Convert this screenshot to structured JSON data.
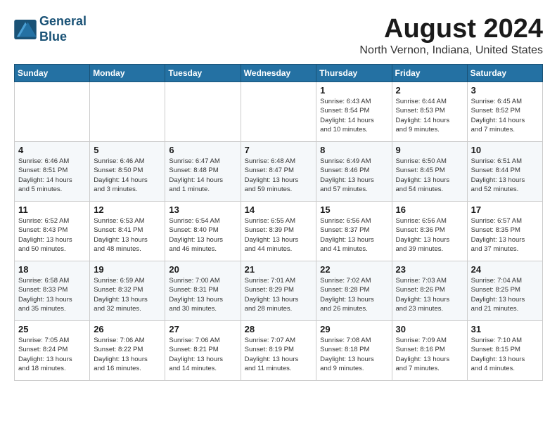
{
  "header": {
    "logo_line1": "General",
    "logo_line2": "Blue",
    "month_title": "August 2024",
    "location": "North Vernon, Indiana, United States"
  },
  "weekdays": [
    "Sunday",
    "Monday",
    "Tuesday",
    "Wednesday",
    "Thursday",
    "Friday",
    "Saturday"
  ],
  "weeks": [
    [
      {
        "day": "",
        "info": ""
      },
      {
        "day": "",
        "info": ""
      },
      {
        "day": "",
        "info": ""
      },
      {
        "day": "",
        "info": ""
      },
      {
        "day": "1",
        "info": "Sunrise: 6:43 AM\nSunset: 8:54 PM\nDaylight: 14 hours\nand 10 minutes."
      },
      {
        "day": "2",
        "info": "Sunrise: 6:44 AM\nSunset: 8:53 PM\nDaylight: 14 hours\nand 9 minutes."
      },
      {
        "day": "3",
        "info": "Sunrise: 6:45 AM\nSunset: 8:52 PM\nDaylight: 14 hours\nand 7 minutes."
      }
    ],
    [
      {
        "day": "4",
        "info": "Sunrise: 6:46 AM\nSunset: 8:51 PM\nDaylight: 14 hours\nand 5 minutes."
      },
      {
        "day": "5",
        "info": "Sunrise: 6:46 AM\nSunset: 8:50 PM\nDaylight: 14 hours\nand 3 minutes."
      },
      {
        "day": "6",
        "info": "Sunrise: 6:47 AM\nSunset: 8:48 PM\nDaylight: 14 hours\nand 1 minute."
      },
      {
        "day": "7",
        "info": "Sunrise: 6:48 AM\nSunset: 8:47 PM\nDaylight: 13 hours\nand 59 minutes."
      },
      {
        "day": "8",
        "info": "Sunrise: 6:49 AM\nSunset: 8:46 PM\nDaylight: 13 hours\nand 57 minutes."
      },
      {
        "day": "9",
        "info": "Sunrise: 6:50 AM\nSunset: 8:45 PM\nDaylight: 13 hours\nand 54 minutes."
      },
      {
        "day": "10",
        "info": "Sunrise: 6:51 AM\nSunset: 8:44 PM\nDaylight: 13 hours\nand 52 minutes."
      }
    ],
    [
      {
        "day": "11",
        "info": "Sunrise: 6:52 AM\nSunset: 8:43 PM\nDaylight: 13 hours\nand 50 minutes."
      },
      {
        "day": "12",
        "info": "Sunrise: 6:53 AM\nSunset: 8:41 PM\nDaylight: 13 hours\nand 48 minutes."
      },
      {
        "day": "13",
        "info": "Sunrise: 6:54 AM\nSunset: 8:40 PM\nDaylight: 13 hours\nand 46 minutes."
      },
      {
        "day": "14",
        "info": "Sunrise: 6:55 AM\nSunset: 8:39 PM\nDaylight: 13 hours\nand 44 minutes."
      },
      {
        "day": "15",
        "info": "Sunrise: 6:56 AM\nSunset: 8:37 PM\nDaylight: 13 hours\nand 41 minutes."
      },
      {
        "day": "16",
        "info": "Sunrise: 6:56 AM\nSunset: 8:36 PM\nDaylight: 13 hours\nand 39 minutes."
      },
      {
        "day": "17",
        "info": "Sunrise: 6:57 AM\nSunset: 8:35 PM\nDaylight: 13 hours\nand 37 minutes."
      }
    ],
    [
      {
        "day": "18",
        "info": "Sunrise: 6:58 AM\nSunset: 8:33 PM\nDaylight: 13 hours\nand 35 minutes."
      },
      {
        "day": "19",
        "info": "Sunrise: 6:59 AM\nSunset: 8:32 PM\nDaylight: 13 hours\nand 32 minutes."
      },
      {
        "day": "20",
        "info": "Sunrise: 7:00 AM\nSunset: 8:31 PM\nDaylight: 13 hours\nand 30 minutes."
      },
      {
        "day": "21",
        "info": "Sunrise: 7:01 AM\nSunset: 8:29 PM\nDaylight: 13 hours\nand 28 minutes."
      },
      {
        "day": "22",
        "info": "Sunrise: 7:02 AM\nSunset: 8:28 PM\nDaylight: 13 hours\nand 26 minutes."
      },
      {
        "day": "23",
        "info": "Sunrise: 7:03 AM\nSunset: 8:26 PM\nDaylight: 13 hours\nand 23 minutes."
      },
      {
        "day": "24",
        "info": "Sunrise: 7:04 AM\nSunset: 8:25 PM\nDaylight: 13 hours\nand 21 minutes."
      }
    ],
    [
      {
        "day": "25",
        "info": "Sunrise: 7:05 AM\nSunset: 8:24 PM\nDaylight: 13 hours\nand 18 minutes."
      },
      {
        "day": "26",
        "info": "Sunrise: 7:06 AM\nSunset: 8:22 PM\nDaylight: 13 hours\nand 16 minutes."
      },
      {
        "day": "27",
        "info": "Sunrise: 7:06 AM\nSunset: 8:21 PM\nDaylight: 13 hours\nand 14 minutes."
      },
      {
        "day": "28",
        "info": "Sunrise: 7:07 AM\nSunset: 8:19 PM\nDaylight: 13 hours\nand 11 minutes."
      },
      {
        "day": "29",
        "info": "Sunrise: 7:08 AM\nSunset: 8:18 PM\nDaylight: 13 hours\nand 9 minutes."
      },
      {
        "day": "30",
        "info": "Sunrise: 7:09 AM\nSunset: 8:16 PM\nDaylight: 13 hours\nand 7 minutes."
      },
      {
        "day": "31",
        "info": "Sunrise: 7:10 AM\nSunset: 8:15 PM\nDaylight: 13 hours\nand 4 minutes."
      }
    ]
  ]
}
